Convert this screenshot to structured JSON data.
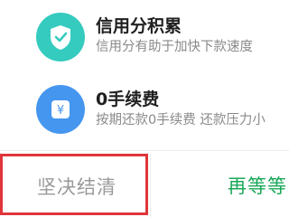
{
  "benefits": [
    {
      "icon": "shield-check-icon",
      "title": "信用分积累",
      "desc": "信用分有助于加快下款速度",
      "color": "#35cbbf"
    },
    {
      "icon": "yen-coin-icon",
      "title": "0手续费",
      "desc": "按期还款0手续费 还款压力小",
      "color": "#4596ef"
    }
  ],
  "actions": {
    "decisive_label": "坚决结清",
    "wait_label": "再等等"
  },
  "colors": {
    "highlight_border": "#e0353b",
    "wait_text": "#1aa85a"
  }
}
